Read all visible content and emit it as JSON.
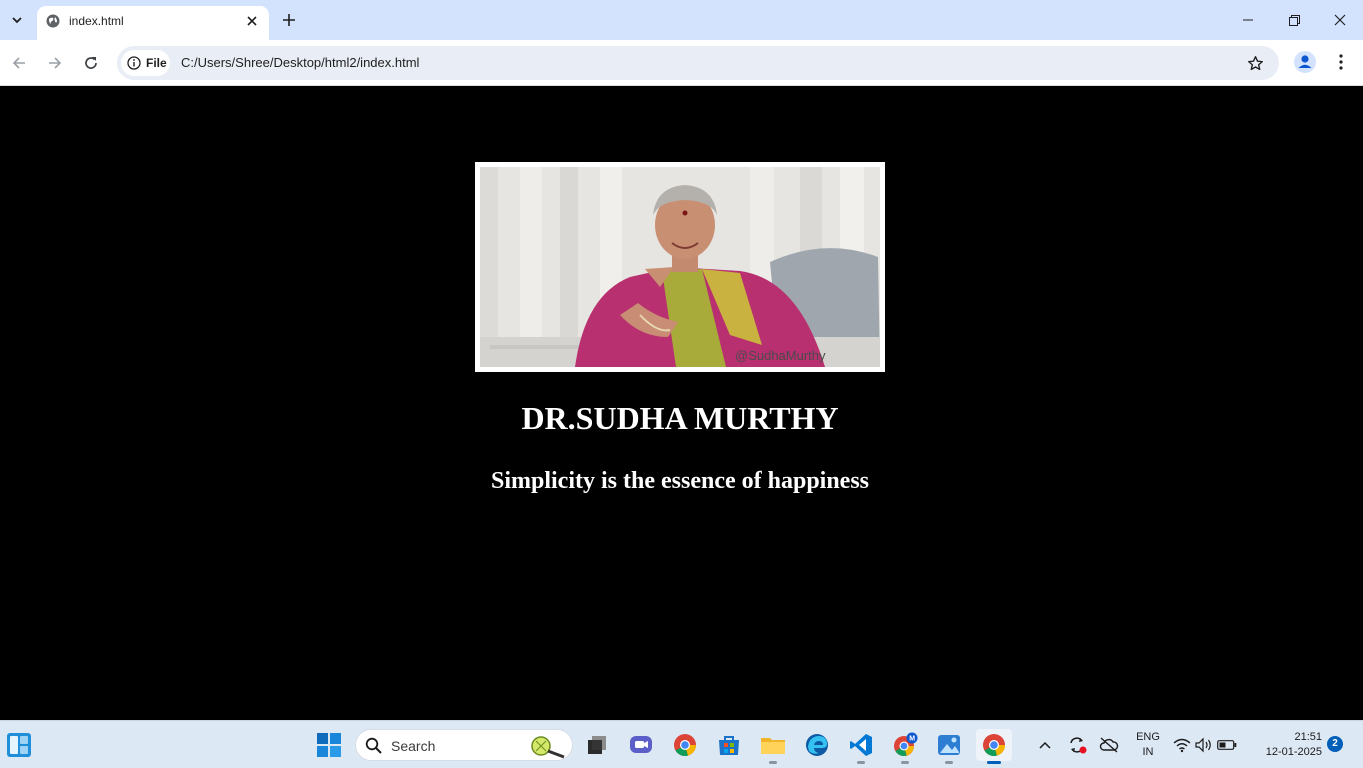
{
  "browser": {
    "tab": {
      "title": "index.html"
    },
    "address": {
      "chip_label": "File",
      "url": "C:/Users/Shree/Desktop/html2/index.html"
    }
  },
  "page": {
    "photo": {
      "watermark": "@SudhaMurthy"
    },
    "heading": "DR.SUDHA MURTHY",
    "quote": "Simplicity is the essence of happiness"
  },
  "taskbar": {
    "search_label": "Search",
    "language": {
      "line1": "ENG",
      "line2": "IN"
    },
    "clock": {
      "time": "21:51",
      "date": "12-01-2025"
    },
    "notification_count": "2"
  }
}
